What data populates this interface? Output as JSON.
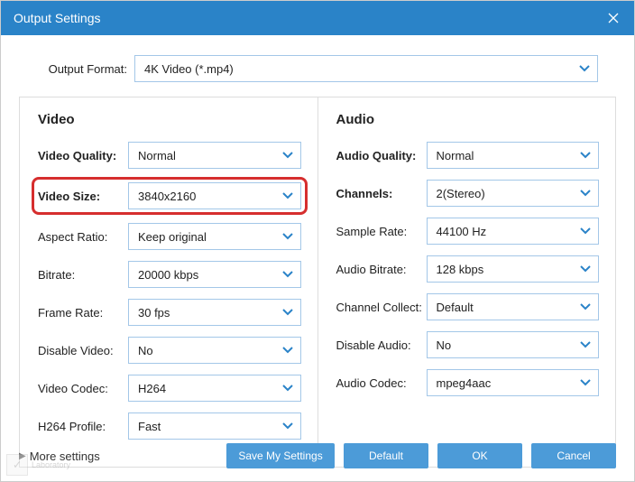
{
  "window": {
    "title": "Output Settings"
  },
  "output_format": {
    "label": "Output Format:",
    "value": "4K Video (*.mp4)"
  },
  "video": {
    "heading": "Video",
    "fields": {
      "quality": {
        "label": "Video Quality:",
        "value": "Normal",
        "bold": true
      },
      "size": {
        "label": "Video Size:",
        "value": "3840x2160",
        "highlight": true
      },
      "aspect": {
        "label": "Aspect Ratio:",
        "value": "Keep original"
      },
      "bitrate": {
        "label": "Bitrate:",
        "value": "20000 kbps"
      },
      "framerate": {
        "label": "Frame Rate:",
        "value": "30 fps"
      },
      "disable": {
        "label": "Disable Video:",
        "value": "No"
      },
      "codec": {
        "label": "Video Codec:",
        "value": "H264"
      },
      "profile": {
        "label": "H264 Profile:",
        "value": "Fast"
      }
    }
  },
  "audio": {
    "heading": "Audio",
    "fields": {
      "quality": {
        "label": "Audio Quality:",
        "value": "Normal",
        "bold": true
      },
      "channels": {
        "label": "Channels:",
        "value": "2(Stereo)",
        "bold": true
      },
      "sample": {
        "label": "Sample Rate:",
        "value": "44100 Hz"
      },
      "bitrate": {
        "label": "Audio Bitrate:",
        "value": "128 kbps"
      },
      "collect": {
        "label": "Channel Collect:",
        "value": "Default"
      },
      "disable": {
        "label": "Disable Audio:",
        "value": "No"
      },
      "codec": {
        "label": "Audio Codec:",
        "value": "mpeg4aac"
      }
    }
  },
  "footer": {
    "more": "More settings",
    "save": "Save My Settings",
    "default": "Default",
    "ok": "OK",
    "cancel": "Cancel"
  },
  "watermark": "Laboratory"
}
